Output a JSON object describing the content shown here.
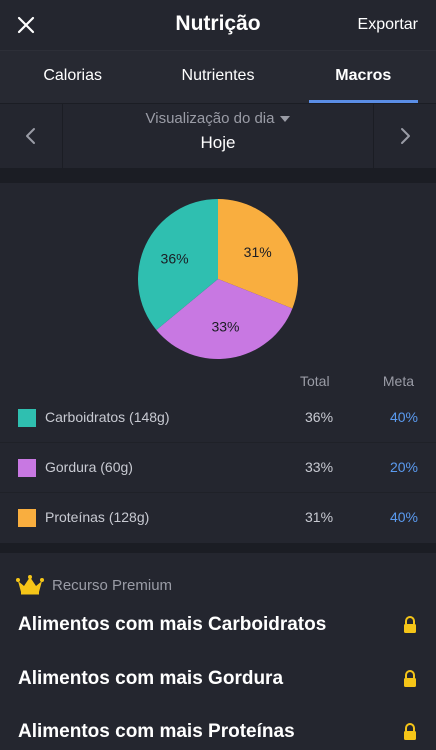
{
  "header": {
    "title": "Nutrição",
    "export_label": "Exportar"
  },
  "tabs": [
    {
      "label": "Calorias",
      "active": false
    },
    {
      "label": "Nutrientes",
      "active": false
    },
    {
      "label": "Macros",
      "active": true
    }
  ],
  "day_selector": {
    "caption": "Visualização do dia",
    "value": "Hoje"
  },
  "chart_data": {
    "type": "pie",
    "slices": [
      {
        "label": "Proteínas",
        "value": 31,
        "color": "#f9ae3f"
      },
      {
        "label": "Gordura",
        "value": 33,
        "color": "#c878e2"
      },
      {
        "label": "Carboidratos",
        "value": 36,
        "color": "#2fbfb0"
      }
    ],
    "slice_labels": [
      "31%",
      "33%",
      "36%"
    ]
  },
  "macros_table": {
    "col_total": "Total",
    "col_goal": "Meta",
    "rows": [
      {
        "name": "Carboidratos (148g)",
        "total": "36%",
        "goal": "40%",
        "color": "#2fbfb0"
      },
      {
        "name": "Gordura (60g)",
        "total": "33%",
        "goal": "20%",
        "color": "#c878e2"
      },
      {
        "name": "Proteínas (128g)",
        "total": "31%",
        "goal": "40%",
        "color": "#f9ae3f"
      }
    ]
  },
  "premium": {
    "label": "Recurso Premium",
    "items": [
      {
        "label": "Alimentos com mais Carboidratos"
      },
      {
        "label": "Alimentos com mais Gordura"
      },
      {
        "label": "Alimentos com mais Proteínas"
      }
    ]
  },
  "colors": {
    "accent": "#5b8ee6",
    "goal_text": "#5b9bf0",
    "premium_gold": "#f5c518"
  }
}
